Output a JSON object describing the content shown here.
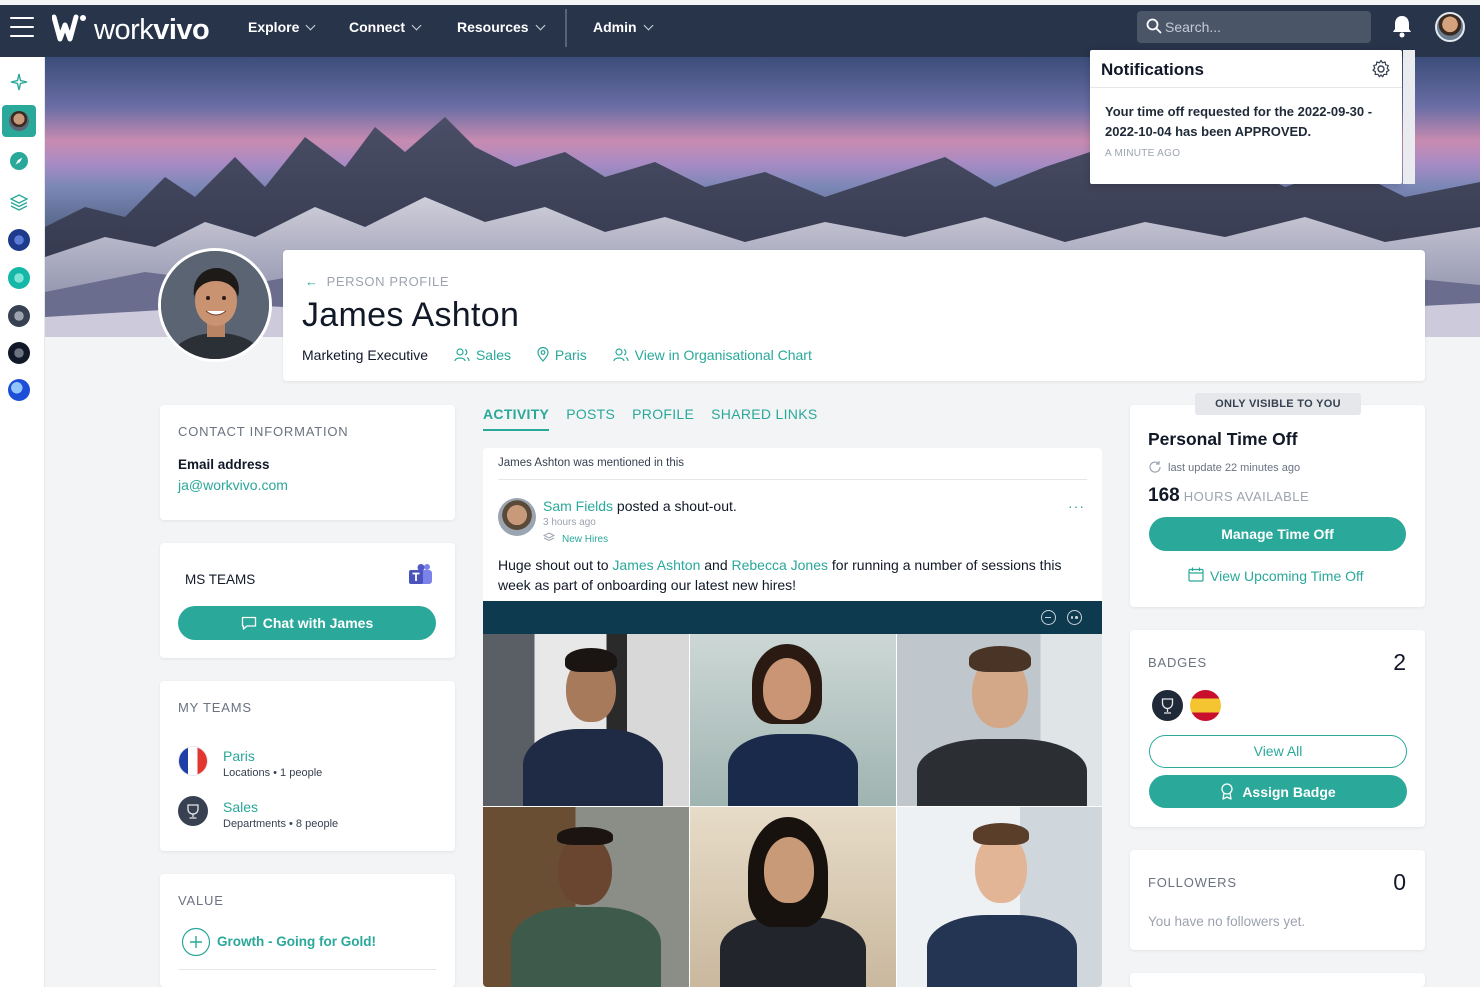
{
  "topbar": {
    "logo_light": "work",
    "logo_bold": "vivo",
    "nav": [
      {
        "label": "Explore"
      },
      {
        "label": "Connect"
      },
      {
        "label": "Resources"
      },
      {
        "label": "Admin"
      }
    ],
    "search_placeholder": "Search..."
  },
  "notifications": {
    "title": "Notifications",
    "items": [
      {
        "message": "Your time off requested for the 2022-09-30 - 2022-10-04 has been APPROVED.",
        "time": "A MINUTE AGO"
      }
    ]
  },
  "profile": {
    "breadcrumb": "PERSON PROFILE",
    "name": "James Ashton",
    "job_title": "Marketing Executive",
    "department": "Sales",
    "location": "Paris",
    "org_chart_link": "View in Organisational Chart"
  },
  "contact": {
    "heading": "CONTACT INFORMATION",
    "email_label": "Email address",
    "email": "ja@workvivo.com"
  },
  "ms_teams": {
    "heading": "MS TEAMS",
    "chat_button": "Chat with James"
  },
  "my_teams": {
    "heading": "MY TEAMS",
    "items": [
      {
        "name": "Paris",
        "meta": "Locations • 1 people"
      },
      {
        "name": "Sales",
        "meta": "Departments • 8 people"
      }
    ]
  },
  "value": {
    "heading": "VALUE",
    "item": "Growth - Going for Gold!"
  },
  "tabs": [
    {
      "label": "ACTIVITY",
      "active": true
    },
    {
      "label": "POSTS",
      "active": false
    },
    {
      "label": "PROFILE",
      "active": false
    },
    {
      "label": "SHARED LINKS",
      "active": false
    }
  ],
  "post": {
    "mention": "James Ashton was mentioned in this",
    "author": "Sam Fields",
    "action": "posted a shout-out.",
    "time": "3 hours ago",
    "group": "New Hires",
    "more": "···",
    "text_1": "Huge shout out to ",
    "mention_1": "James Ashton",
    "text_2": " and ",
    "mention_2": "Rebecca Jones",
    "text_3": " for running a number of sessions this week as part of onboarding our latest new hires!"
  },
  "time_off": {
    "visibility": "ONLY VISIBLE TO YOU",
    "heading": "Personal Time Off",
    "last_update": "last update 22 minutes ago",
    "hours": "168",
    "hours_label": "HOURS AVAILABLE",
    "manage_button": "Manage Time Off",
    "upcoming_link": "View Upcoming Time Off"
  },
  "badges": {
    "heading": "BADGES",
    "count": "2",
    "view_all": "View All",
    "assign_button": "Assign Badge"
  },
  "followers": {
    "heading": "FOLLOWERS",
    "count": "0",
    "empty": "You have no followers yet."
  },
  "colors": {
    "accent": "#2aa89a",
    "topbar": "#28344a",
    "video_bar": "#0e3a4f"
  }
}
